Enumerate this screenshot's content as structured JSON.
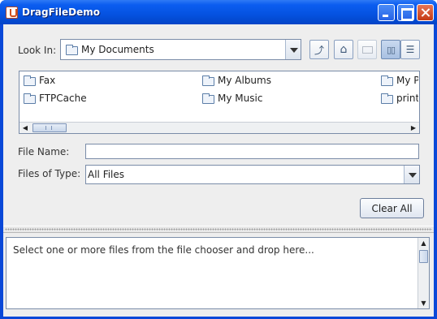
{
  "window": {
    "title": "DragFileDemo"
  },
  "chooser": {
    "look_in_label": "Look In:",
    "look_in_value": "My Documents",
    "files": [
      {
        "name": "Fax"
      },
      {
        "name": "My Albums"
      },
      {
        "name": "My Pi"
      },
      {
        "name": "FTPCache"
      },
      {
        "name": "My Music"
      },
      {
        "name": "print_"
      }
    ],
    "file_name_label": "File Name:",
    "file_name_value": "",
    "files_of_type_label": "Files of Type:",
    "files_of_type_value": "All Files"
  },
  "actions": {
    "clear_all_label": "Clear All"
  },
  "drop_area": {
    "text": "Select one or more files from the file chooser and drop here..."
  },
  "colors": {
    "titlebar": "#0552e0",
    "background": "#eeeeee",
    "close_button": "#c53a14"
  }
}
